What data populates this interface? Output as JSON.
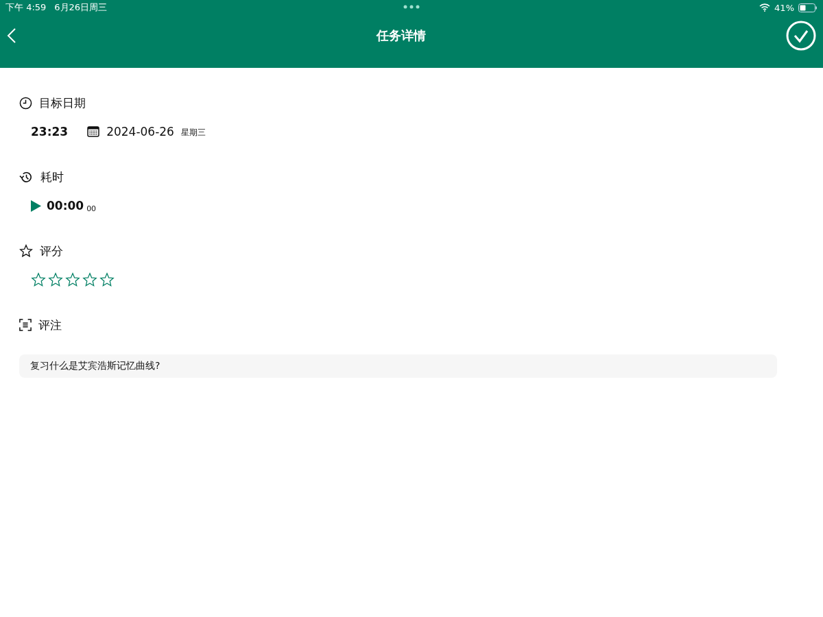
{
  "status_bar": {
    "time": "下午 4:59",
    "date": "6月26日周三",
    "battery": "41%"
  },
  "header": {
    "title": "任务详情"
  },
  "sections": [
    {
      "kind": "date",
      "title": "目标日期",
      "time": "23:23",
      "date": "2024-06-26",
      "weekday": "星期三"
    },
    {
      "kind": "duration",
      "title": "耗时",
      "elapsed": "00:00",
      "fraction": "00"
    },
    {
      "kind": "rating",
      "title": "评分",
      "stars": 0
    },
    {
      "kind": "note",
      "title": "评注",
      "text": "复习什么是艾宾浩斯记忆曲线?"
    }
  ]
}
